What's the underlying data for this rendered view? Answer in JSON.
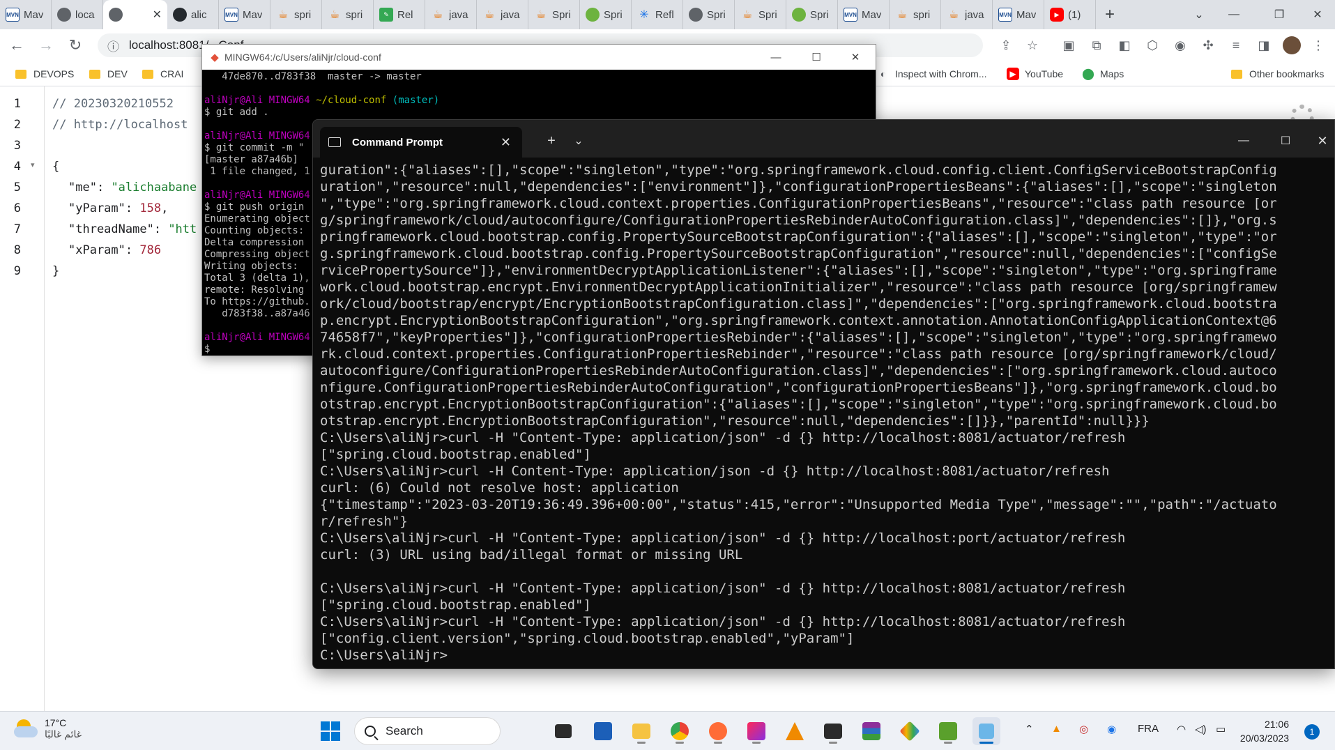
{
  "browser": {
    "tabs": [
      {
        "icon": "mvn",
        "label": "Mav"
      },
      {
        "icon": "globe",
        "label": "loca"
      },
      {
        "icon": "globe",
        "label": "",
        "active": true,
        "close": "✕"
      },
      {
        "icon": "git",
        "label": "alic"
      },
      {
        "icon": "mvn",
        "label": "Mav"
      },
      {
        "icon": "java",
        "label": "spri"
      },
      {
        "icon": "java",
        "label": "spri"
      },
      {
        "icon": "rel",
        "label": "Rel"
      },
      {
        "icon": "java",
        "label": "java"
      },
      {
        "icon": "java",
        "label": "java"
      },
      {
        "icon": "java",
        "label": "Spri"
      },
      {
        "icon": "spring",
        "label": "Spri"
      },
      {
        "icon": "refl",
        "label": "Refl"
      },
      {
        "icon": "globe",
        "label": "Spri"
      },
      {
        "icon": "java",
        "label": "Spri"
      },
      {
        "icon": "spring",
        "label": "Spri"
      },
      {
        "icon": "mvn",
        "label": "Mav"
      },
      {
        "icon": "java",
        "label": "spri"
      },
      {
        "icon": "java",
        "label": "java"
      },
      {
        "icon": "mvn",
        "label": "Mav"
      },
      {
        "icon": "yt",
        "label": "(1)"
      }
    ],
    "address": "localhost:8081/...Conf...",
    "bookmarks": [
      {
        "type": "folder",
        "label": "DEVOPS"
      },
      {
        "type": "folder",
        "label": "DEV"
      },
      {
        "type": "folder",
        "label": "CRAI"
      },
      {
        "type": "link",
        "label": "Inspect with Chrom..."
      },
      {
        "type": "link",
        "label": "YouTube"
      },
      {
        "type": "link",
        "label": "Maps"
      },
      {
        "type": "folder",
        "label": "Other bookmarks"
      }
    ]
  },
  "json_view": {
    "line_numbers": [
      "1",
      "2",
      "3",
      "4",
      "5",
      "6",
      "7",
      "8",
      "9"
    ],
    "comment_timestamp": "// 20230320210552",
    "comment_url": "// http://localhost",
    "open_brace": "{",
    "close_brace": "}",
    "entries": [
      {
        "key": "\"me\"",
        "sep": ": ",
        "value": "\"alichaabane",
        "type": "str",
        "tail": ""
      },
      {
        "key": "\"yParam\"",
        "sep": ": ",
        "value": "158",
        "type": "num",
        "tail": ","
      },
      {
        "key": "\"threadName\"",
        "sep": ": ",
        "value": "\"htt",
        "type": "str",
        "tail": ""
      },
      {
        "key": "\"xParam\"",
        "sep": ": ",
        "value": "786",
        "type": "num",
        "tail": ""
      }
    ]
  },
  "mintty": {
    "title": "MINGW64:/c/Users/aliNjr/cloud-conf",
    "prompt_user": "aliNjr@Ali",
    "prompt_host": "MINGW64",
    "prompt_path": "~/cloud-conf",
    "prompt_branch": "(master)",
    "line_top": "   47de870..d783f38  master -> master",
    "cmd_add": "$ git add .",
    "cmd_commit": "$ git commit -m \"",
    "commit_out1": "[master a87a46b] ",
    "commit_out2": " 1 file changed, 1",
    "cmd_push": "$ git push origin",
    "push_out": [
      "Enumerating object",
      "Counting objects:",
      "Delta compression",
      "Compressing object",
      "Writing objects: ",
      "Total 3 (delta 1),",
      "remote: Resolving ",
      "To https://github.",
      "   d783f38..a87a46"
    ],
    "cursor_line": "$ "
  },
  "cmd": {
    "tab_title": "Command Prompt",
    "output_lines": [
      "guration\":{\"aliases\":[],\"scope\":\"singleton\",\"type\":\"org.springframework.cloud.config.client.ConfigServiceBootstrapConfig",
      "uration\",\"resource\":null,\"dependencies\":[\"environment\"]},\"configurationPropertiesBeans\":{\"aliases\":[],\"scope\":\"singleton",
      "\",\"type\":\"org.springframework.cloud.context.properties.ConfigurationPropertiesBeans\",\"resource\":\"class path resource [or",
      "g/springframework/cloud/autoconfigure/ConfigurationPropertiesRebinderAutoConfiguration.class]\",\"dependencies\":[]},\"org.s",
      "pringframework.cloud.bootstrap.config.PropertySourceBootstrapConfiguration\":{\"aliases\":[],\"scope\":\"singleton\",\"type\":\"or",
      "g.springframework.cloud.bootstrap.config.PropertySourceBootstrapConfiguration\",\"resource\":null,\"dependencies\":[\"configSe",
      "rvicePropertySource\"]},\"environmentDecryptApplicationListener\":{\"aliases\":[],\"scope\":\"singleton\",\"type\":\"org.springframe",
      "work.cloud.bootstrap.encrypt.EnvironmentDecryptApplicationInitializer\",\"resource\":\"class path resource [org/springframew",
      "ork/cloud/bootstrap/encrypt/EncryptionBootstrapConfiguration.class]\",\"dependencies\":[\"org.springframework.cloud.bootstra",
      "p.encrypt.EncryptionBootstrapConfiguration\",\"org.springframework.context.annotation.AnnotationConfigApplicationContext@6",
      "74658f7\",\"keyProperties\"]},\"configurationPropertiesRebinder\":{\"aliases\":[],\"scope\":\"singleton\",\"type\":\"org.springframewo",
      "rk.cloud.context.properties.ConfigurationPropertiesRebinder\",\"resource\":\"class path resource [org/springframework/cloud/",
      "autoconfigure/ConfigurationPropertiesRebinderAutoConfiguration.class]\",\"dependencies\":[\"org.springframework.cloud.autoco",
      "nfigure.ConfigurationPropertiesRebinderAutoConfiguration\",\"configurationPropertiesBeans\"]},\"org.springframework.cloud.bo",
      "otstrap.encrypt.EncryptionBootstrapConfiguration\":{\"aliases\":[],\"scope\":\"singleton\",\"type\":\"org.springframework.cloud.bo",
      "otstrap.encrypt.EncryptionBootstrapConfiguration\",\"resource\":null,\"dependencies\":[]}},\"parentId\":null}}}",
      "C:\\Users\\aliNjr>curl -H \"Content-Type: application/json\" -d {} http://localhost:8081/actuator/refresh",
      "[\"spring.cloud.bootstrap.enabled\"]",
      "C:\\Users\\aliNjr>curl -H Content-Type: application/json -d {} http://localhost:8081/actuator/refresh",
      "curl: (6) Could not resolve host: application",
      "{\"timestamp\":\"2023-03-20T19:36:49.396+00:00\",\"status\":415,\"error\":\"Unsupported Media Type\",\"message\":\"\",\"path\":\"/actuato",
      "r/refresh\"}",
      "C:\\Users\\aliNjr>curl -H \"Content-Type: application/json\" -d {} http://localhost:port/actuator/refresh",
      "curl: (3) URL using bad/illegal format or missing URL",
      "",
      "C:\\Users\\aliNjr>curl -H \"Content-Type: application/json\" -d {} http://localhost:8081/actuator/refresh",
      "[\"spring.cloud.bootstrap.enabled\"]",
      "C:\\Users\\aliNjr>curl -H \"Content-Type: application/json\" -d {} http://localhost:8081/actuator/refresh",
      "[\"config.client.version\",\"spring.cloud.bootstrap.enabled\",\"yParam\"]",
      "C:\\Users\\aliNjr>"
    ]
  },
  "taskbar": {
    "weather_temp": "17°C",
    "weather_desc": "غائم غالبًا",
    "search_label": "Search",
    "language": "FRA",
    "time": "21:06",
    "date": "20/03/2023",
    "notification_count": "1",
    "colors": {
      "accent": "#0067c0"
    }
  }
}
